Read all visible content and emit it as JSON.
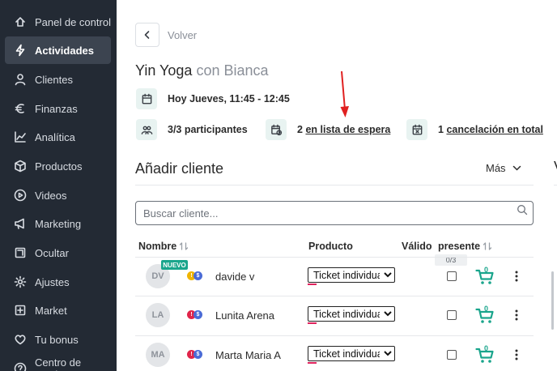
{
  "sidebar": {
    "items": [
      {
        "label": "Panel de control",
        "icon": "home-icon"
      },
      {
        "label": "Actividades",
        "icon": "bolt-icon",
        "active": true
      },
      {
        "label": "Clientes",
        "icon": "user-icon"
      },
      {
        "label": "Finanzas",
        "icon": "euro-icon"
      },
      {
        "label": "Analítica",
        "icon": "chart-line-icon"
      },
      {
        "label": "Productos",
        "icon": "box-icon"
      },
      {
        "label": "Videos",
        "icon": "play-circle-icon"
      },
      {
        "label": "Marketing",
        "icon": "megaphone-icon"
      },
      {
        "label": "Ocultar",
        "icon": "square-icon"
      },
      {
        "label": "Ajustes",
        "icon": "gear-icon"
      },
      {
        "label": "Market",
        "icon": "plus-square-icon"
      },
      {
        "label": "Tu bonus",
        "icon": "heart-icon"
      },
      {
        "label": "Centro de ayuda",
        "icon": "help-icon"
      }
    ]
  },
  "header": {
    "back_label": "Volver",
    "title_main": "Yin Yoga",
    "title_sub": "con Bianca",
    "schedule": "Hoy Jueves, 11:45 - 12:45",
    "participants": "3/3 participantes",
    "waitlist_count": "2",
    "waitlist_label": "en lista de espera",
    "cancel_count": "1",
    "cancel_label": "cancelación en total"
  },
  "add_client": {
    "title": "Añadir cliente",
    "more_label": "Más",
    "search_placeholder": "Buscar cliente..."
  },
  "table": {
    "columns": {
      "name": "Nombre",
      "product": "Producto",
      "valid": "Válido",
      "present": "presente"
    },
    "present_count": "0/3",
    "new_badge": "NUEVO",
    "rows": [
      {
        "initials": "DV",
        "name": "davide v",
        "product": "Ticket individual",
        "status": "yellow",
        "cart_count": "0"
      },
      {
        "initials": "LA",
        "name": "Lunita Arena",
        "product": "Ticket individual",
        "status": "red",
        "cart_count": "0"
      },
      {
        "initials": "MA",
        "name": "Marta Maria A",
        "product": "Ticket individual",
        "status": "red",
        "cart_count": "0"
      }
    ]
  },
  "right_edge_char": "V",
  "colors": {
    "sidebar_bg": "#232a34",
    "accent": "#1aa58c",
    "arrow": "#e02020",
    "badge_blue": "#4a6bd6",
    "badge_red": "#e0244a",
    "badge_yellow": "#f0b400"
  }
}
